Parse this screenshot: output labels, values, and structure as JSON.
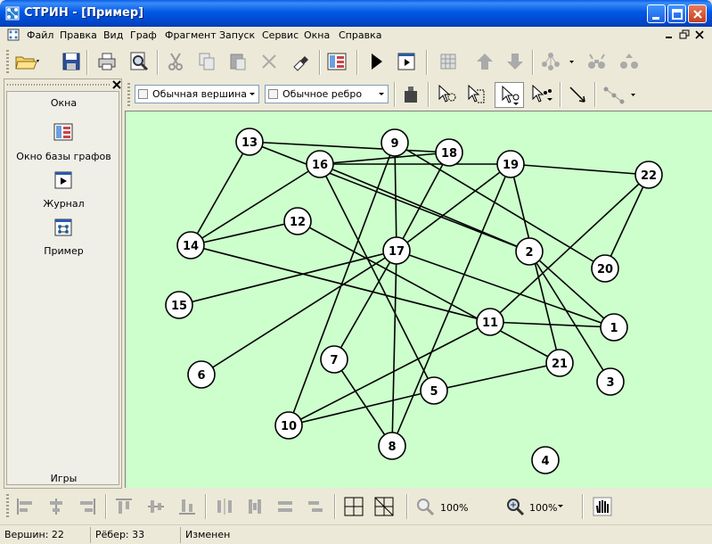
{
  "window": {
    "title": "СТРИН - [Пример]"
  },
  "menu": {
    "items": [
      "Файл",
      "Правка",
      "Вид",
      "Граф",
      "Фрагмент",
      "Запуск",
      "Сервис",
      "Окна",
      "Справка"
    ]
  },
  "toolbar_main": {
    "icons": [
      "open-folder-icon",
      "save-icon",
      "print-icon",
      "print-preview-icon",
      "cut-icon",
      "copy-icon",
      "paste-icon",
      "delete-icon",
      "undo-icon",
      "graph-database-icon",
      "run-icon",
      "journal-icon",
      "grid-icon",
      "arrow-up-icon",
      "arrow-down-icon",
      "tree-icon",
      "find-icon",
      "find-next-icon"
    ]
  },
  "toolbar_graph": {
    "vertex_combo": "Обычная вершина",
    "edge_combo": "Обычное ребро"
  },
  "sidepanel": {
    "header": "Окна",
    "items": [
      {
        "label": "Окно базы графов",
        "icon": "graph-database-icon"
      },
      {
        "label": "Журнал",
        "icon": "journal-icon"
      },
      {
        "label": "Пример",
        "icon": "graph-window-icon"
      }
    ],
    "footer": "Игры"
  },
  "bottom_toolbar": {
    "zoom1": "100%",
    "zoom2": "100%"
  },
  "statusbar": {
    "vertices": "Вершин: 22",
    "edges": "Рёбер: 33",
    "state": "Изменен"
  },
  "graph": {
    "vertices": [
      {
        "id": "13"
      },
      {
        "id": "9"
      },
      {
        "id": "18"
      },
      {
        "id": "16"
      },
      {
        "id": "19"
      },
      {
        "id": "22"
      },
      {
        "id": "12"
      },
      {
        "id": "14"
      },
      {
        "id": "17"
      },
      {
        "id": "2"
      },
      {
        "id": "20"
      },
      {
        "id": "15"
      },
      {
        "id": "11"
      },
      {
        "id": "1"
      },
      {
        "id": "7"
      },
      {
        "id": "6"
      },
      {
        "id": "21"
      },
      {
        "id": "3"
      },
      {
        "id": "5"
      },
      {
        "id": "10"
      },
      {
        "id": "8"
      },
      {
        "id": "4"
      }
    ],
    "edges": [
      [
        "13",
        "14"
      ],
      [
        "13",
        "18"
      ],
      [
        "13",
        "2"
      ],
      [
        "9",
        "17"
      ],
      [
        "9",
        "10"
      ],
      [
        "9",
        "20"
      ],
      [
        "18",
        "16"
      ],
      [
        "18",
        "17"
      ],
      [
        "16",
        "14"
      ],
      [
        "16",
        "19"
      ],
      [
        "16",
        "2"
      ],
      [
        "16",
        "5"
      ],
      [
        "19",
        "22"
      ],
      [
        "19",
        "17"
      ],
      [
        "19",
        "21"
      ],
      [
        "19",
        "8"
      ],
      [
        "22",
        "20"
      ],
      [
        "22",
        "11"
      ],
      [
        "12",
        "14"
      ],
      [
        "12",
        "21"
      ],
      [
        "14",
        "11"
      ],
      [
        "17",
        "15"
      ],
      [
        "17",
        "6"
      ],
      [
        "17",
        "1"
      ],
      [
        "17",
        "8"
      ],
      [
        "7",
        "17"
      ],
      [
        "7",
        "8"
      ],
      [
        "2",
        "1"
      ],
      [
        "2",
        "3"
      ],
      [
        "11",
        "1"
      ],
      [
        "11",
        "10"
      ],
      [
        "5",
        "21"
      ],
      [
        "5",
        "10"
      ]
    ]
  }
}
